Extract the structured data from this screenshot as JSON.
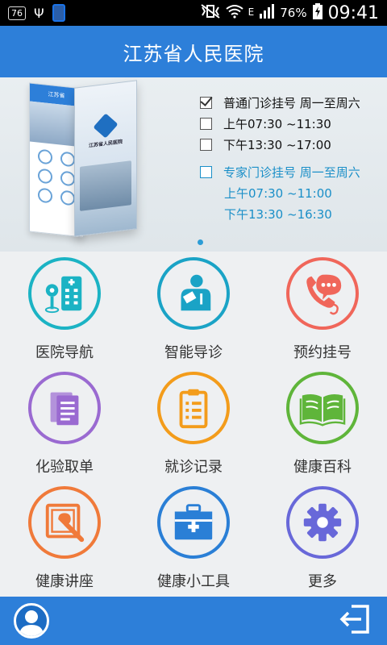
{
  "status_bar": {
    "badge": "76",
    "battery_percent": "76%",
    "network_type": "E",
    "time": "09:41"
  },
  "header": {
    "title": "江苏省人民医院"
  },
  "banner": {
    "phone_header": "江苏省",
    "phone_name": "江苏省人民医院",
    "general": {
      "title": "普通门诊挂号 周一至周六",
      "morning": "上午07:30 ~11:30",
      "afternoon": "下午13:30 ~17:00"
    },
    "expert": {
      "title": "专家门诊挂号 周一至周六",
      "morning": "上午07:30 ~11:00",
      "afternoon": "下午13:30 ~16:30"
    },
    "page_index": 1,
    "page_count": 1
  },
  "menu": [
    {
      "label": "医院导航",
      "icon": "hospital-navigation-icon",
      "color": "#1bb3c4"
    },
    {
      "label": "智能导诊",
      "icon": "smart-triage-icon",
      "color": "#1aa3c6"
    },
    {
      "label": "预约挂号",
      "icon": "phone-appointment-icon",
      "color": "#f0665a"
    },
    {
      "label": "化验取单",
      "icon": "lab-report-icon",
      "color": "#9a6ad1"
    },
    {
      "label": "就诊记录",
      "icon": "clipboard-records-icon",
      "color": "#f39c1b"
    },
    {
      "label": "健康百科",
      "icon": "open-book-icon",
      "color": "#5fb53a"
    },
    {
      "label": "健康讲座",
      "icon": "lecture-pen-icon",
      "color": "#f07a3a"
    },
    {
      "label": "健康小工具",
      "icon": "medical-kit-icon",
      "color": "#2a7fd6"
    },
    {
      "label": "更多",
      "icon": "gear-icon",
      "color": "#6868d9"
    }
  ],
  "colors": {
    "primary": "#2d7fd9",
    "accent_blue": "#1a8fc8"
  }
}
